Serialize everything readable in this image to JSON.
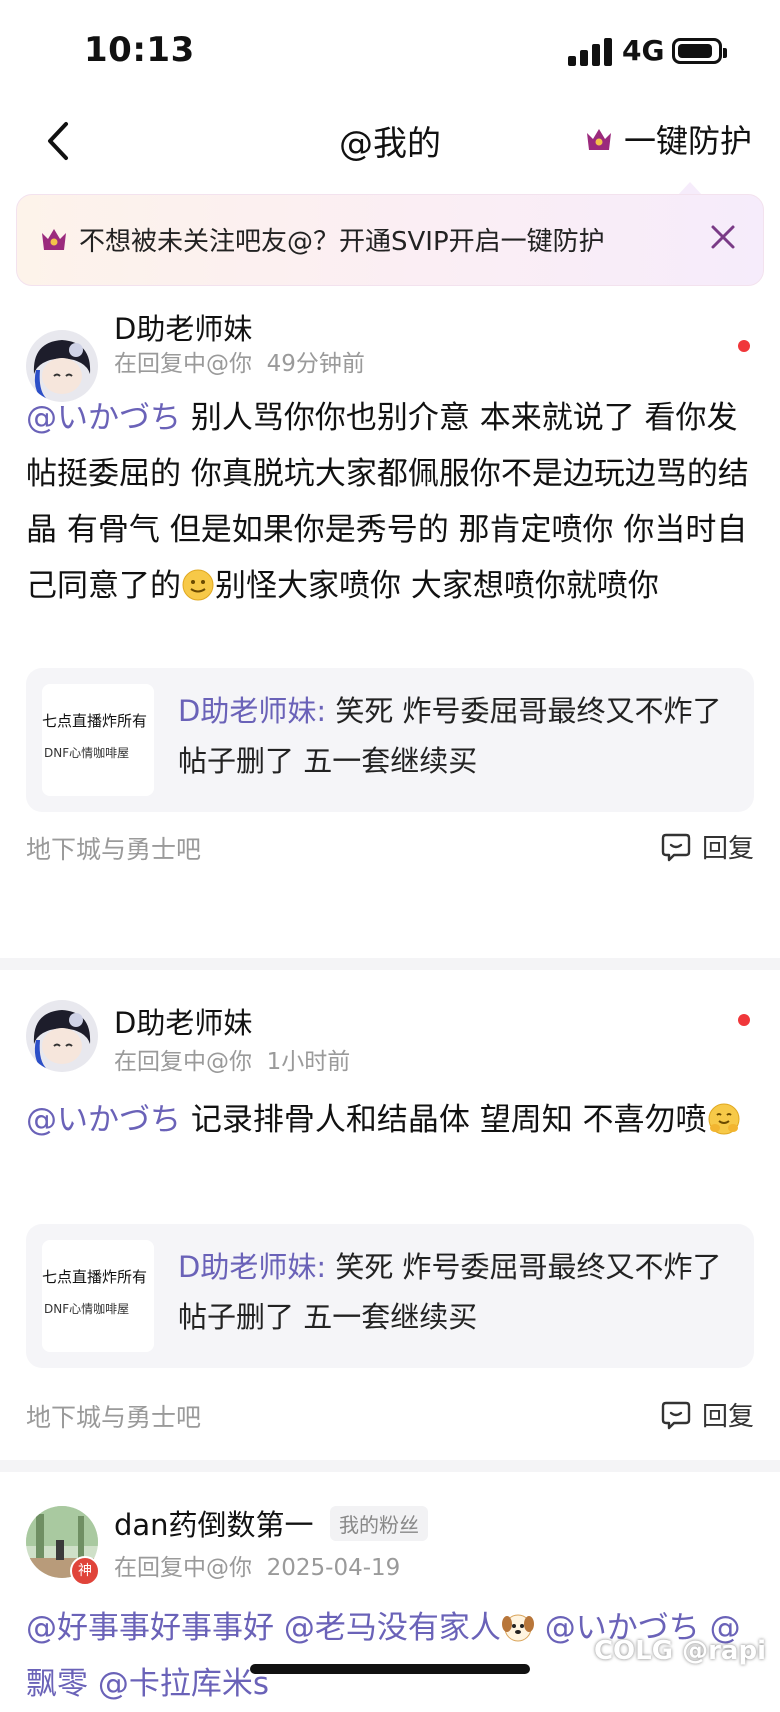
{
  "status": {
    "time": "10:13",
    "network": "4G"
  },
  "nav": {
    "title": "@我的",
    "protect_label": "一键防护"
  },
  "banner": {
    "text": "不想被未关注吧友@？开通SVIP开启一键防护"
  },
  "posts": [
    {
      "username": "D助老师妹",
      "meta_prefix": "在回复中@你",
      "time": "49分钟前",
      "mention": "@いかづち",
      "text_a": " 别人骂你你也别介意 本来就说了 看你发帖挺委屈的 你真脱坑大家都佩服你不是边玩边骂的结晶 有骨气 但是如果你是秀号的 那肯定喷你 你当时自己同意了的",
      "text_b": "别怪大家喷你 大家想喷你就喷你",
      "quote_thumb_title": "七点直播炸所有",
      "quote_thumb_sub": "DNF心情咖啡屋",
      "quote_name": "D助老师妹:",
      "quote_text": " 笑死  炸号委屈哥最终又不炸了  帖子删了  五一套继续买",
      "forum": "地下城与勇士吧",
      "reply": "回复"
    },
    {
      "username": "D助老师妹",
      "meta_prefix": "在回复中@你",
      "time": "1小时前",
      "mention": "@いかづち",
      "text_a": " 记录排骨人和结晶体 望周知 不喜勿喷",
      "quote_thumb_title": "七点直播炸所有",
      "quote_thumb_sub": "DNF心情咖啡屋",
      "quote_name": "D助老师妹:",
      "quote_text": " 笑死  炸号委屈哥最终又不炸了  帖子删了  五一套继续买",
      "forum": "地下城与勇士吧",
      "reply": "回复"
    },
    {
      "username": "dan药倒数第一",
      "fan_badge": "我的粉丝",
      "avatar_badge": "神",
      "meta_prefix": "在回复中@你",
      "time": "2025-04-19",
      "mention_1": "@好事事好事事好",
      "mention_2": " @老马没有家人",
      "mention_3": " @いかづち",
      "mention_4": " @飘零",
      "mention_5": " @卡拉库米s"
    }
  ],
  "watermark": "COLG @rapi"
}
